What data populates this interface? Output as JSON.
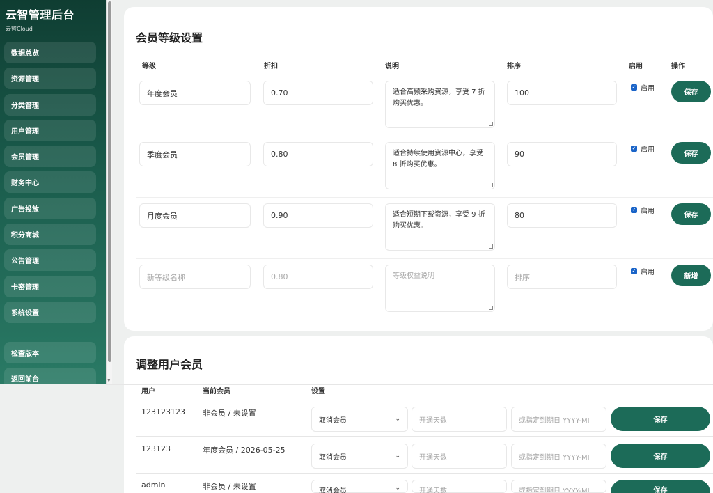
{
  "sidebar": {
    "title": "云智管理后台",
    "subtitle": "云智Cloud",
    "items": [
      {
        "label": "数据总览"
      },
      {
        "label": "资源管理"
      },
      {
        "label": "分类管理"
      },
      {
        "label": "用户管理"
      },
      {
        "label": "会员管理"
      },
      {
        "label": "财务中心"
      },
      {
        "label": "广告投放"
      },
      {
        "label": "积分商城"
      },
      {
        "label": "公告管理"
      },
      {
        "label": "卡密管理"
      },
      {
        "label": "系统设置"
      }
    ],
    "bottom_items": [
      {
        "label": "检查版本"
      },
      {
        "label": "返回前台"
      }
    ]
  },
  "membership_levels": {
    "title": "会员等级设置",
    "headers": {
      "level": "等级",
      "discount": "折扣",
      "description": "说明",
      "sort": "排序",
      "enabled": "启用",
      "action": "操作"
    },
    "rows": [
      {
        "name": "年度会员",
        "discount": "0.70",
        "description": "适合高频采购资源，享受 7 折购买优惠。",
        "sort": "100",
        "enabled_label": "启用",
        "button": "保存"
      },
      {
        "name": "季度会员",
        "discount": "0.80",
        "description": "适合持续使用资源中心，享受 8 折购买优惠。",
        "sort": "90",
        "enabled_label": "启用",
        "button": "保存"
      },
      {
        "name": "月度会员",
        "discount": "0.90",
        "description": "适合短期下载资源，享受 9 折购买优惠。",
        "sort": "80",
        "enabled_label": "启用",
        "button": "保存"
      }
    ],
    "new_row": {
      "name_placeholder": "新等级名称",
      "discount_placeholder": "0.80",
      "description_placeholder": "等级权益说明",
      "sort_placeholder": "排序",
      "enabled_label": "启用",
      "button": "新增"
    }
  },
  "adjust_members": {
    "title": "调整用户会员",
    "headers": {
      "user": "用户",
      "current": "当前会员",
      "settings": "设置"
    },
    "rows": [
      {
        "user": "123123123",
        "current": "非会员 / 未设置",
        "select": "取消会员",
        "days_placeholder": "开通天数",
        "date_placeholder": "或指定到期日 YYYY-MI",
        "button": "保存"
      },
      {
        "user": "123123",
        "current": "年度会员 / 2026-05-25",
        "select": "取消会员",
        "days_placeholder": "开通天数",
        "date_placeholder": "或指定到期日 YYYY-MI",
        "button": "保存"
      },
      {
        "user": "admin",
        "current": "非会员 / 未设置",
        "select": "取消会员",
        "days_placeholder": "开通天数",
        "date_placeholder": "或指定到期日 YYYY-MI",
        "button": "保存"
      }
    ]
  }
}
